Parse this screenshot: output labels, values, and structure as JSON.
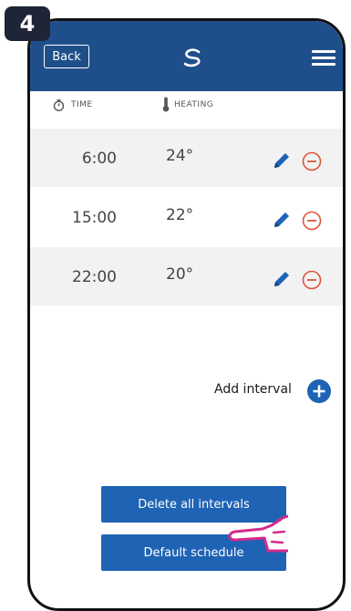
{
  "step": "4",
  "header": {
    "back_label": "Back",
    "logo_icon": "logo-icon",
    "menu_icon": "hamburger-menu-icon",
    "color": "#1f4f8b"
  },
  "columns": {
    "time_label": "TIME",
    "heating_label": "HEATING"
  },
  "intervals": [
    {
      "time": "6:00",
      "temp": "24°"
    },
    {
      "time": "15:00",
      "temp": "22°"
    },
    {
      "time": "22:00",
      "temp": "20°"
    }
  ],
  "add_interval_label": "Add interval",
  "buttons": {
    "delete_all": "Delete all intervals",
    "default_schedule": "Default schedule"
  },
  "colors": {
    "button": "#1f63b5",
    "remove": "#e0533a",
    "pointer": "#d42a8c"
  }
}
